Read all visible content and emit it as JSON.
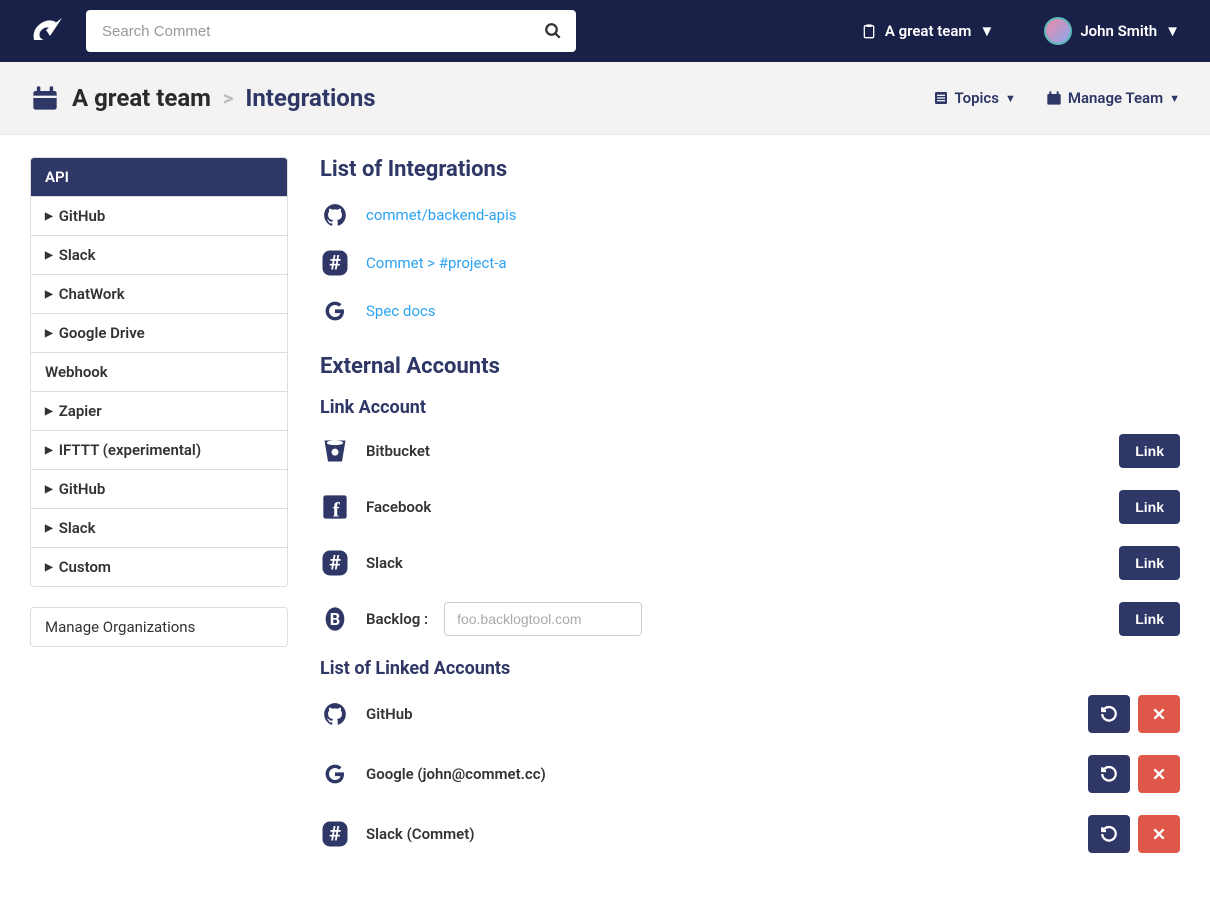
{
  "header": {
    "search_placeholder": "Search Commet",
    "team_label": "A great team",
    "user_name": "John Smith"
  },
  "breadcrumb": {
    "team": "A great team",
    "page": "Integrations",
    "topics_label": "Topics",
    "manage_label": "Manage Team"
  },
  "sidebar": {
    "items": [
      {
        "label": "API",
        "expandable": false,
        "active": true
      },
      {
        "label": "GitHub",
        "expandable": true
      },
      {
        "label": "Slack",
        "expandable": true
      },
      {
        "label": "ChatWork",
        "expandable": true
      },
      {
        "label": "Google Drive",
        "expandable": true
      },
      {
        "label": "Webhook",
        "expandable": false
      },
      {
        "label": "Zapier",
        "expandable": true
      },
      {
        "label": "IFTTT (experimental)",
        "expandable": true
      },
      {
        "label": "GitHub",
        "expandable": true
      },
      {
        "label": "Slack",
        "expandable": true
      },
      {
        "label": "Custom",
        "expandable": true
      }
    ],
    "manage_orgs": "Manage Organizations"
  },
  "main": {
    "list_title": "List of Integrations",
    "integrations": [
      {
        "icon": "github",
        "label": "commet/backend-apis"
      },
      {
        "icon": "slack",
        "label": "Commet > #project-a"
      },
      {
        "icon": "google",
        "label": "Spec docs"
      }
    ],
    "external_title": "External Accounts",
    "link_account_title": "Link Account",
    "link_button": "Link",
    "link_accounts": [
      {
        "icon": "bitbucket",
        "label": "Bitbucket"
      },
      {
        "icon": "facebook",
        "label": "Facebook"
      },
      {
        "icon": "slack",
        "label": "Slack"
      }
    ],
    "backlog_label": "Backlog :",
    "backlog_placeholder": "foo.backlogtool.com",
    "linked_title": "List of Linked Accounts",
    "linked_accounts": [
      {
        "icon": "github",
        "label": "GitHub"
      },
      {
        "icon": "google",
        "label": "Google (john@commet.cc)"
      },
      {
        "icon": "slack",
        "label": "Slack (Commet)"
      }
    ]
  }
}
